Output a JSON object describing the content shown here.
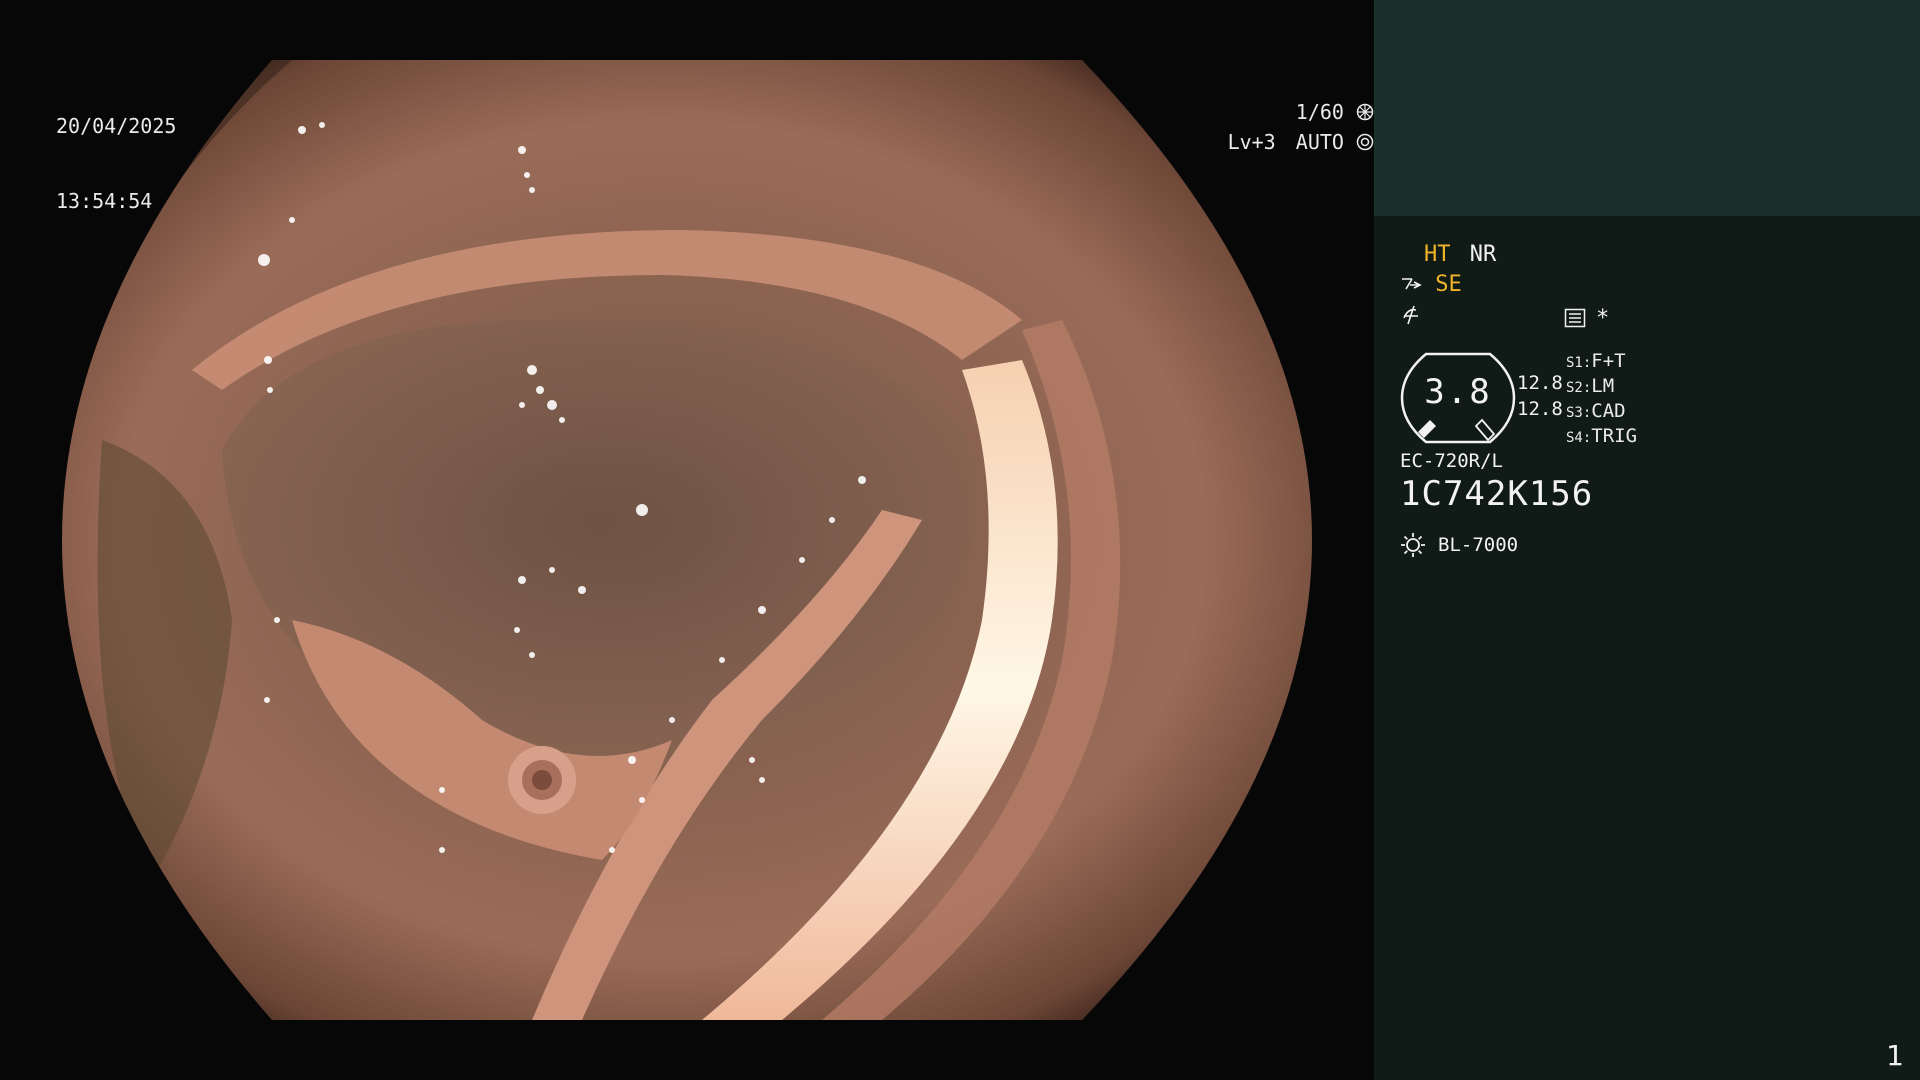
{
  "osd": {
    "date": "20/04/2025",
    "time": "13:54:54",
    "shutter": "1/60",
    "level": "Lv+3",
    "mode": "AUTO"
  },
  "sidebar": {
    "ht": "HT",
    "nr": "NR",
    "se": "SE",
    "asterisk": "*",
    "gauge_value": "3.8",
    "readout_1": "12.8",
    "readout_2": "12.8",
    "switches": [
      {
        "key": "S1:",
        "value": "F+T"
      },
      {
        "key": "S2:",
        "value": "LM"
      },
      {
        "key": "S3:",
        "value": "CAD"
      },
      {
        "key": "S4:",
        "value": "TRIG"
      }
    ],
    "scope_model": "EC-720R/L",
    "serial": "1C742K156",
    "light_source": "BL-7000"
  },
  "page_number": "1",
  "colors": {
    "accent_yellow": "#f0b428",
    "sidebar_bg": "#101a17",
    "sidebar_top_bg": "#1a302d",
    "tissue": "#8a5a48"
  },
  "icons": [
    "iris-icon",
    "auto-iris-icon",
    "scope-tip-icon",
    "zoom-icon",
    "menu-icon",
    "light-source-icon"
  ]
}
